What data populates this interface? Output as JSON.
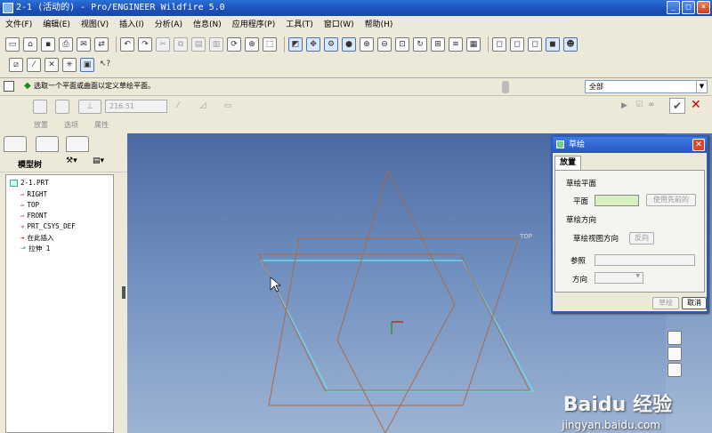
{
  "window": {
    "title": "2-1 (活动的) - Pro/ENGINEER Wildfire 5.0",
    "minimize": "_",
    "maximize": "□",
    "close": "×"
  },
  "menu": [
    "文件(F)",
    "编辑(E)",
    "视图(V)",
    "插入(I)",
    "分析(A)",
    "信息(N)",
    "应用程序(P)",
    "工具(T)",
    "窗口(W)",
    "帮助(H)"
  ],
  "prompt": {
    "message": "选取一个平面或曲面以定义草绘平面。",
    "filter": "全部"
  },
  "dashboard": {
    "depth_value": "216.51",
    "tabs": [
      "放置",
      "选项",
      "属性"
    ]
  },
  "navigator": {
    "title": "模型树",
    "items": [
      {
        "label": "2-1.PRT"
      },
      {
        "label": "RIGHT"
      },
      {
        "label": "TOP"
      },
      {
        "label": "FRONT"
      },
      {
        "label": "PRT_CSYS_DEF"
      },
      {
        "label": "在此插入"
      },
      {
        "label": "拉伸 1"
      }
    ]
  },
  "canvas": {
    "plane_label": "TOP"
  },
  "dialog": {
    "title": "草绘",
    "tab": "放置",
    "section_plane": "草绘平面",
    "plane_label": "平面",
    "use_previous": "使用先前的",
    "section_orientation": "草绘方向",
    "view_direction": "草绘视图方向",
    "flip": "反向",
    "reference": "参照",
    "direction": "方向",
    "sketch_btn": "草绘",
    "cancel_btn": "取消"
  },
  "watermark": {
    "brand": "Baidu 经验",
    "url": "jingyan.baidu.com"
  }
}
